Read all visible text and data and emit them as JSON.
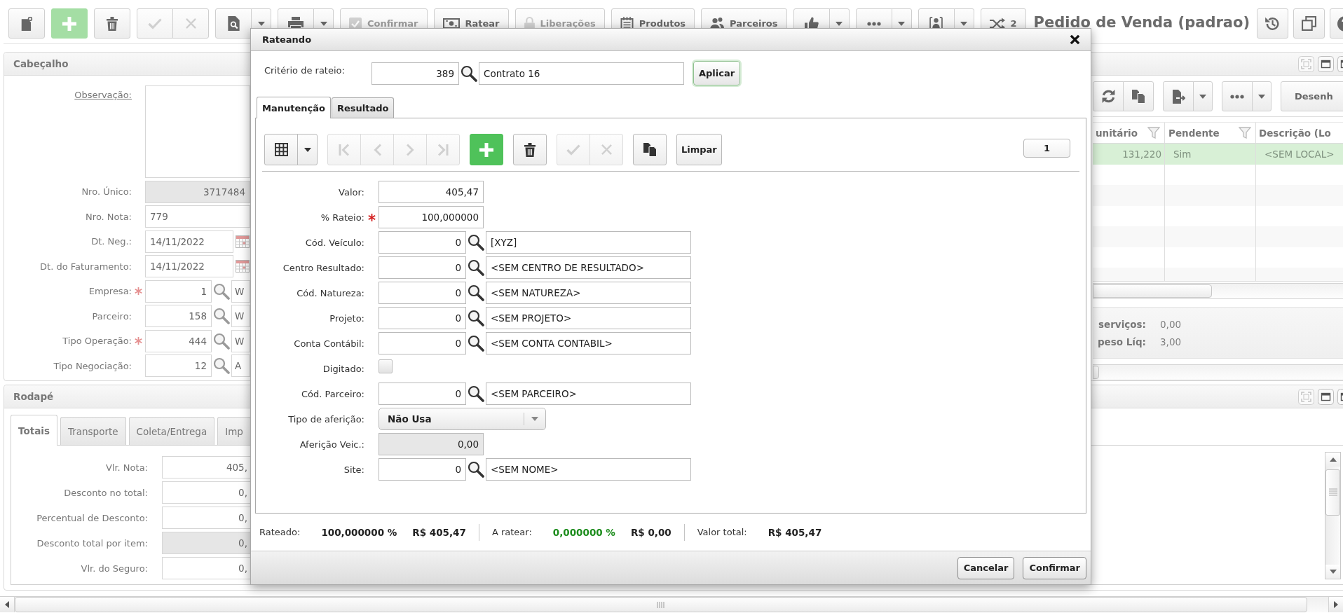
{
  "toolbar": {
    "groups": [
      {
        "buttons": [
          {
            "kind": "icon",
            "disabled": false
          }
        ]
      },
      {
        "buttons": [
          {
            "kind": "primary",
            "disabled": false
          }
        ]
      },
      {
        "buttons": [
          {
            "kind": "icon",
            "disabled": false
          }
        ]
      },
      {
        "buttons": [
          {
            "kind": "icon",
            "disabled": true
          },
          {
            "kind": "icon",
            "disabled": true
          }
        ]
      },
      {
        "buttons": [
          {
            "kind": "split",
            "disabled": false
          }
        ]
      },
      {
        "buttons": [
          {
            "kind": "split",
            "disabled": false
          }
        ]
      },
      {
        "buttons": [
          {
            "kind": "text",
            "label": "Confirmar",
            "disabled": true
          }
        ]
      },
      {
        "buttons": [
          {
            "kind": "text",
            "label": "Ratear",
            "disabled": false
          }
        ]
      },
      {
        "buttons": [
          {
            "kind": "text",
            "label": "Liberações",
            "disabled": true
          }
        ]
      },
      {
        "buttons": [
          {
            "kind": "text",
            "label": "Produtos",
            "disabled": false
          }
        ]
      },
      {
        "buttons": [
          {
            "kind": "text",
            "label": "Parceiros",
            "disabled": false
          }
        ]
      },
      {
        "buttons": [
          {
            "kind": "split",
            "disabled": false
          }
        ]
      },
      {
        "buttons": [
          {
            "kind": "split",
            "disabled": false
          }
        ]
      },
      {
        "buttons": [
          {
            "kind": "split",
            "disabled": false
          }
        ]
      },
      {
        "buttons": [
          {
            "kind": "text",
            "label": "2",
            "disabled": false
          }
        ]
      }
    ],
    "title": "Pedido de Venda (padrao)"
  },
  "header_panel": {
    "title": "Cabeçalho",
    "fields": [
      {
        "label": "Observação:",
        "kind": "memo",
        "required": false
      },
      {
        "label": "Nro. Único:",
        "kind": "readonly",
        "value": "3717484",
        "required": false
      },
      {
        "label": "Nro. Nota:",
        "kind": "text",
        "value": "779",
        "required": false
      },
      {
        "label": "Dt. Neg.:",
        "kind": "date",
        "value": "14/11/2022",
        "required": false
      },
      {
        "label": "Dt. do Faturamento:",
        "kind": "date",
        "value": "14/11/2022",
        "required": false
      },
      {
        "label": "Empresa:",
        "kind": "lookup",
        "code": "1",
        "description": "W",
        "required": true
      },
      {
        "label": "Parceiro:",
        "kind": "lookup",
        "code": "158",
        "description": "W",
        "required": false
      },
      {
        "label": "Tipo Operação:",
        "kind": "lookup",
        "code": "444",
        "description": "W",
        "required": true
      },
      {
        "label": "Tipo Negociação:",
        "kind": "lookup",
        "code": "12",
        "description": "A",
        "required": false
      }
    ],
    "tools": {
      "groups": [
        {
          "buttons": [
            {
              "kind": "icon",
              "disabled": false
            },
            {
              "kind": "icon",
              "disabled": false
            }
          ]
        },
        {
          "buttons": [
            {
              "kind": "split",
              "disabled": false
            }
          ]
        },
        {
          "buttons": [
            {
              "kind": "split",
              "disabled": false
            }
          ]
        },
        {
          "buttons": [
            {
              "kind": "text",
              "label": "Desenh",
              "disabled": false
            }
          ]
        }
      ]
    },
    "grid": {
      "columns": [
        {
          "label": "unitário",
          "kind": "number",
          "filter": true
        },
        {
          "label": "Pendente",
          "kind": "text",
          "filter": true
        },
        {
          "label": "Descrição (Lo",
          "kind": "text",
          "filter": false
        }
      ],
      "rows": [
        {
          "cells": [
            "131,220",
            "Sim",
            "<SEM LOCAL>"
          ],
          "selected": true
        }
      ]
    },
    "totals": [
      {
        "label": "serviços:",
        "value": "0,00"
      },
      {
        "label": "peso Líq:",
        "value": "3,00"
      }
    ]
  },
  "footer_panel": {
    "title": "Rodapé",
    "tabs": [
      {
        "label": "Totais",
        "selected": true
      },
      {
        "label": "Transporte",
        "selected": false
      },
      {
        "label": "Coleta/Entrega",
        "selected": false
      },
      {
        "label": "Imp",
        "selected": false
      }
    ],
    "fields": [
      {
        "label": "Vlr. Nota:",
        "value": "405,",
        "readonly": false
      },
      {
        "label": "Desconto no total:",
        "value": "0,",
        "readonly": false
      },
      {
        "label": "Percentual de Desconto:",
        "value": "0,",
        "readonly": false
      },
      {
        "label": "Desconto total por item:",
        "value": "0,",
        "readonly": true
      },
      {
        "label": "Vlr. do Seguro:",
        "value": "0,",
        "readonly": false
      }
    ]
  },
  "dialog": {
    "title": "Rateando",
    "criteria": {
      "label": "Critério de rateio:",
      "code": "389",
      "description": "Contrato 16",
      "action": "Aplicar"
    },
    "tabs": [
      {
        "label": "Manutenção",
        "selected": true
      },
      {
        "label": "Resultado",
        "selected": false
      }
    ],
    "tools": {
      "groups": [
        {
          "buttons": [
            {
              "kind": "split",
              "disabled": false
            }
          ]
        },
        {
          "buttons": [
            {
              "kind": "icon",
              "disabled": true
            },
            {
              "kind": "icon",
              "disabled": true
            },
            {
              "kind": "icon",
              "disabled": true
            },
            {
              "kind": "icon",
              "disabled": true
            }
          ]
        },
        {
          "buttons": [
            {
              "kind": "primary",
              "disabled": false
            }
          ]
        },
        {
          "buttons": [
            {
              "kind": "icon",
              "disabled": false
            }
          ]
        },
        {
          "buttons": [
            {
              "kind": "icon",
              "disabled": true
            },
            {
              "kind": "icon",
              "disabled": true
            }
          ]
        },
        {
          "buttons": [
            {
              "kind": "icon",
              "disabled": false
            }
          ]
        },
        {
          "buttons": [
            {
              "kind": "text",
              "label": "Limpar",
              "disabled": false
            }
          ]
        }
      ]
    },
    "record_count": "1",
    "fields": [
      {
        "label": "Valor:",
        "kind": "number",
        "value": "405,47",
        "required": false
      },
      {
        "label": "% Rateio:",
        "kind": "number",
        "value": "100,000000",
        "required": true
      },
      {
        "label": "Cód. Veículo:",
        "kind": "lookup",
        "code": "0",
        "description": "[XYZ]",
        "required": false
      },
      {
        "label": "Centro Resultado:",
        "kind": "lookup",
        "code": "0",
        "description": "<SEM CENTRO DE RESULTADO>",
        "required": false
      },
      {
        "label": "Cód. Natureza:",
        "kind": "lookup",
        "code": "0",
        "description": "<SEM NATUREZA>",
        "required": false
      },
      {
        "label": "Projeto:",
        "kind": "lookup",
        "code": "0",
        "description": "<SEM PROJETO>",
        "required": false
      },
      {
        "label": "Conta Contábil:",
        "kind": "lookup",
        "code": "0",
        "description": "<SEM CONTA CONTABIL>",
        "required": false
      },
      {
        "label": "Digitado:",
        "kind": "checkbox",
        "checked": false,
        "required": false
      },
      {
        "label": "Cód. Parceiro:",
        "kind": "lookup",
        "code": "0",
        "description": "<SEM PARCEIRO>",
        "required": false
      },
      {
        "label": "Tipo de aferição:",
        "kind": "select",
        "value": "Não Usa",
        "required": false
      },
      {
        "label": "Aferição Veic.:",
        "kind": "readonly",
        "value": "0,00",
        "required": false
      },
      {
        "label": "Site:",
        "kind": "lookup",
        "code": "0",
        "description": "<SEM NOME>",
        "required": false
      }
    ],
    "summary": [
      {
        "label": "Rateado:",
        "percent": "100,000000 %",
        "amount": "R$ 405,47",
        "highlight": false
      },
      {
        "label": "A ratear:",
        "percent": "0,000000 %",
        "amount": "R$ 0,00",
        "highlight": true
      },
      {
        "label": "Valor total:",
        "amount": "R$ 405,47",
        "highlight": false
      }
    ],
    "buttons": [
      {
        "label": "Cancelar"
      },
      {
        "label": "Confirmar"
      }
    ]
  }
}
